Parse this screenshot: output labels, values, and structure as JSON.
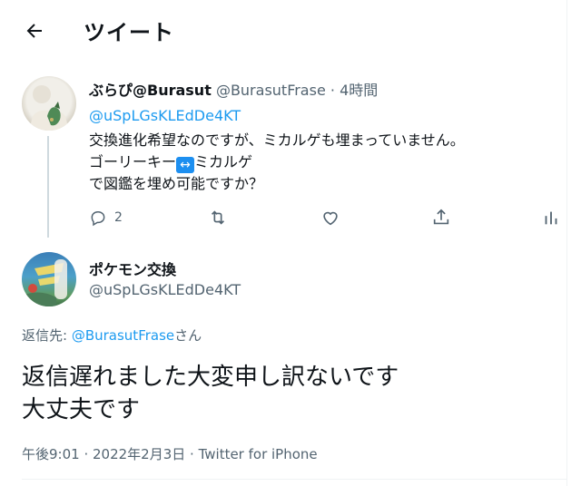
{
  "header": {
    "title": "ツイート",
    "back_icon": "arrow-left-icon"
  },
  "tweet1": {
    "display_name": "ぶらぴ@Burasut",
    "handle": "@BurasutFrase",
    "separator": " · ",
    "time": "4時間",
    "mention": "@uSpLGsKLEdDe4KT",
    "body_line1": "交換進化希望なのですが、ミカルゲも埋まっていません。",
    "body_line2_a": "ゴーリーキー",
    "body_line2_emoji": "↔",
    "body_line2_b": "ミカルゲ",
    "body_line3": "で図鑑を埋め可能ですか？",
    "reply_count": "2",
    "icons": [
      "reply-icon",
      "retweet-icon",
      "like-icon",
      "share-icon",
      "analytics-icon"
    ]
  },
  "tweet2": {
    "display_name": "ポケモン交換",
    "handle": "@uSpLGsKLEdDe4KT",
    "reply_prefix": "返信先: ",
    "reply_to": "@BurasutFrase",
    "reply_suffix": "さん",
    "text_line1": "返信遅れました大変申し訳ないです",
    "text_line2": "大丈夫です",
    "time": "午後9:01",
    "date_sep": " · ",
    "date": "2022年2月3日",
    "client_sep": " · ",
    "client": "Twitter for iPhone"
  },
  "colors": {
    "link": "#1d9bf0",
    "muted": "#536471",
    "text": "#0f1419"
  }
}
